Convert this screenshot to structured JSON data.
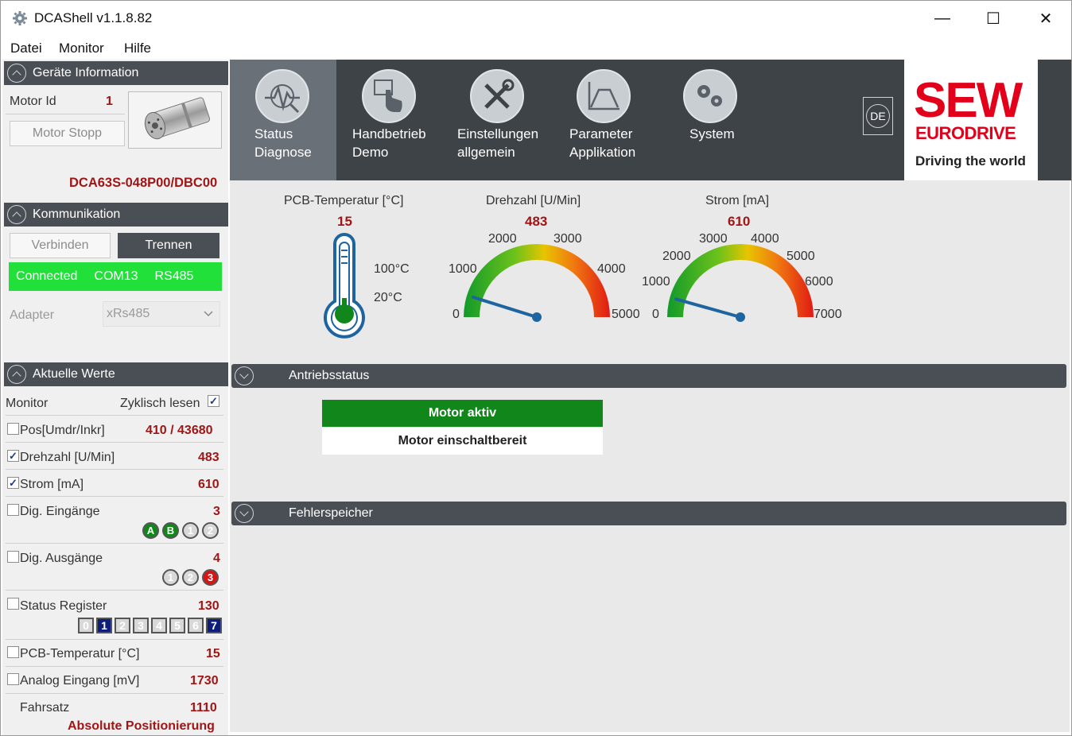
{
  "window": {
    "title": "DCAShell v1.1.8.82",
    "minimize": "—",
    "maximize": "☐",
    "close": "✕"
  },
  "menu": [
    "Datei",
    "Monitor",
    "Hilfe"
  ],
  "geraete": {
    "header": "Geräte Information",
    "motor_id_label": "Motor Id",
    "motor_id_value": "1",
    "motor_stopp": "Motor Stopp",
    "model": "DCA63S-048P00/DBC00"
  },
  "kommunikation": {
    "header": "Kommunikation",
    "verbinden": "Verbinden",
    "trennen": "Trennen",
    "status": "Connected",
    "port": "COM13",
    "protocol": "RS485",
    "status_color": "#22e03a",
    "adapter_label": "Adapter",
    "adapter_value": "xRs485"
  },
  "aktuelle": {
    "header": "Aktuelle Werte",
    "monitor_label": "Monitor",
    "zyklisch_label": "Zyklisch lesen",
    "zyklisch_checked": true,
    "rows": [
      {
        "label": "Pos[Umdr/Inkr]",
        "value": "410 / 43680",
        "checked": false
      },
      {
        "label": "Drehzahl [U/Min]",
        "value": "483",
        "checked": true
      },
      {
        "label": "Strom [mA]",
        "value": "610",
        "checked": true
      },
      {
        "label": "Dig. Eingänge",
        "value": "3",
        "checked": false
      },
      {
        "label": "Dig. Ausgänge",
        "value": "4",
        "checked": false
      },
      {
        "label": "Status Register",
        "value": "130",
        "checked": false
      },
      {
        "label": "PCB-Temperatur [°C]",
        "value": "15",
        "checked": false
      },
      {
        "label": "Analog Eingang [mV]",
        "value": "1730",
        "checked": false
      }
    ],
    "inputs": [
      "A",
      "B",
      "1",
      "2"
    ],
    "outputs": [
      "1",
      "2",
      "3"
    ],
    "register_bits": [
      "0",
      "1",
      "2",
      "3",
      "4",
      "5",
      "6",
      "7"
    ],
    "fahrsatz_label": "Fahrsatz",
    "fahrsatz_value": "1110",
    "fahrsatz_mode": "Absolute Positionierung"
  },
  "toolbar": [
    {
      "line1": "Status",
      "line2": "Diagnose",
      "icon": "status-diagnose-icon"
    },
    {
      "line1": "Handbetrieb",
      "line2": "Demo",
      "icon": "hand-touch-icon"
    },
    {
      "line1": "Einstellungen",
      "line2": "allgemein",
      "icon": "tools-icon"
    },
    {
      "line1": "Parameter",
      "line2": "Applikation",
      "icon": "parameter-curve-icon"
    },
    {
      "line1": "System",
      "line2": "",
      "icon": "gears-icon"
    }
  ],
  "language": "DE",
  "logo": {
    "sew": "SEW",
    "eurodrive": "EURODRIVE",
    "slogan": "Driving the world"
  },
  "gauges": {
    "temp": {
      "title": "PCB-Temperatur [°C]",
      "value": "15",
      "mark_high": "100°C",
      "mark_low": "20°C"
    },
    "drehzahl": {
      "title": "Drehzahl [U/Min]",
      "value": "483",
      "ticks": [
        "0",
        "1000",
        "2000",
        "3000",
        "4000",
        "5000"
      ],
      "fraction": 0.0966
    },
    "strom": {
      "title": "Strom [mA]",
      "value": "610",
      "ticks": [
        "0",
        "1000",
        "2000",
        "3000",
        "4000",
        "5000",
        "6000",
        "7000"
      ],
      "fraction": 0.087
    }
  },
  "antrieb": {
    "header": "Antriebsstatus",
    "active": "Motor aktiv",
    "ready": "Motor einschaltbereit",
    "active_color": "#11871b"
  },
  "fehler": {
    "header": "Fehlerspeicher"
  }
}
